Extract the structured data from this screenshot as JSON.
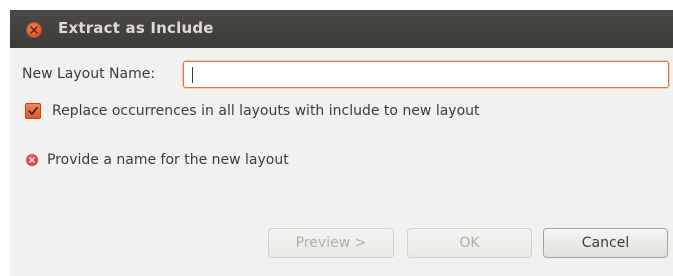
{
  "window": {
    "title": "Extract as Include"
  },
  "form": {
    "name_label": "New Layout Name:",
    "name_value": "",
    "checkbox_label": "Replace occurrences in all layouts with include to new layout",
    "checkbox_checked": true,
    "error_message": "Provide a name for the new layout"
  },
  "buttons": {
    "preview_label": "Preview >",
    "ok_label": "OK",
    "cancel_label": "Cancel"
  },
  "colors": {
    "titlebar": "#3c3b37",
    "accent": "#e4733c",
    "error": "#cc2a1e",
    "dialog_background": "#f2f1f0"
  }
}
